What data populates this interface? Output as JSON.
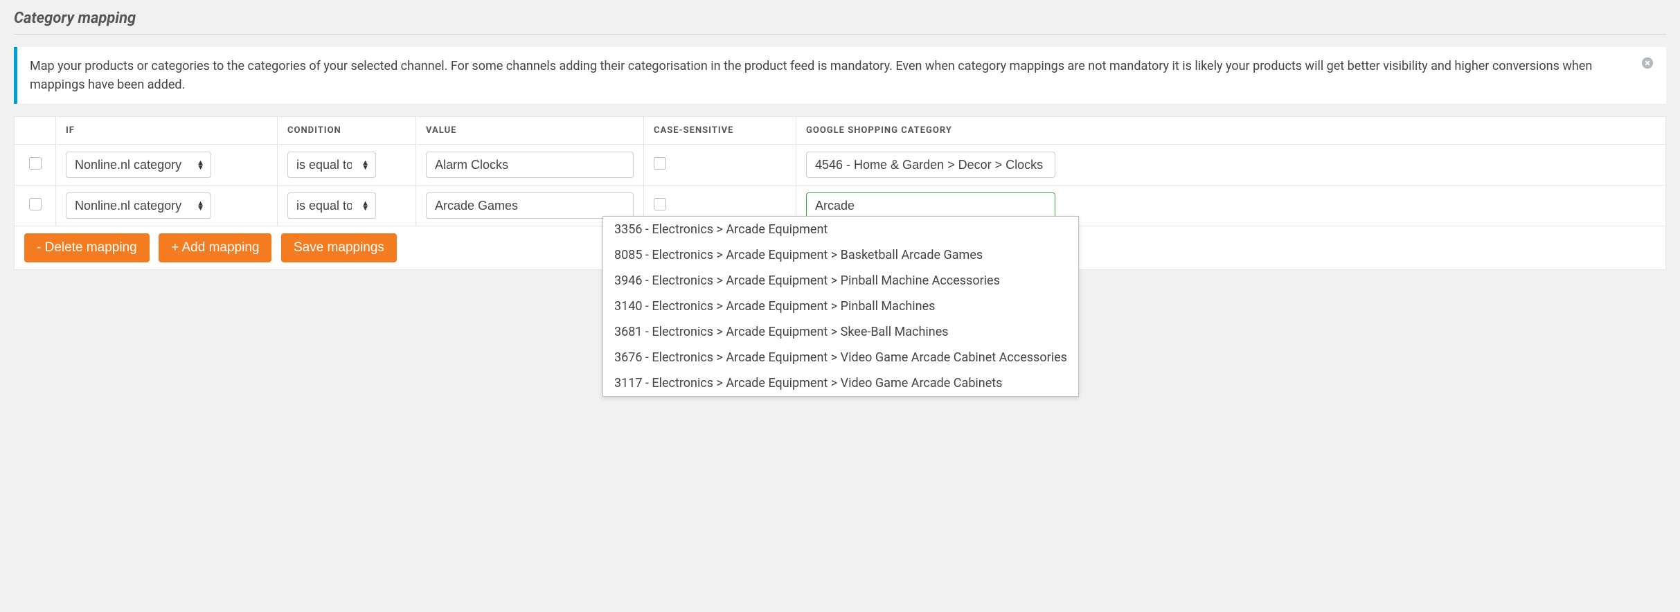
{
  "section_title": "Category mapping",
  "notice_text": "Map your products or categories to the categories of your selected channel. For some channels adding their categorisation in the product feed is mandatory. Even when category mappings are not mandatory it is likely your products will get better visibility and higher conversions when mappings have been added.",
  "headers": {
    "if": "IF",
    "condition": "CONDITION",
    "value": "VALUE",
    "case_sensitive": "CASE-SENSITIVE",
    "gsc": "GOOGLE SHOPPING CATEGORY"
  },
  "rows": [
    {
      "if_value": "Nonline.nl category",
      "condition_value": "is equal to",
      "value": "Alarm Clocks",
      "gsc": "4546 - Home & Garden > Decor > Clocks"
    },
    {
      "if_value": "Nonline.nl category",
      "condition_value": "is equal to",
      "value": "Arcade Games",
      "gsc": "Arcade"
    }
  ],
  "buttons": {
    "delete": "- Delete mapping",
    "add": "+ Add mapping",
    "save": "Save mappings"
  },
  "autocomplete": [
    "3356 - Electronics > Arcade Equipment",
    "8085 - Electronics > Arcade Equipment > Basketball Arcade Games",
    "3946 - Electronics > Arcade Equipment > Pinball Machine Accessories",
    "3140 - Electronics > Arcade Equipment > Pinball Machines",
    "3681 - Electronics > Arcade Equipment > Skee-Ball Machines",
    "3676 - Electronics > Arcade Equipment > Video Game Arcade Cabinet Accessories",
    "3117 - Electronics > Arcade Equipment > Video Game Arcade Cabinets"
  ]
}
